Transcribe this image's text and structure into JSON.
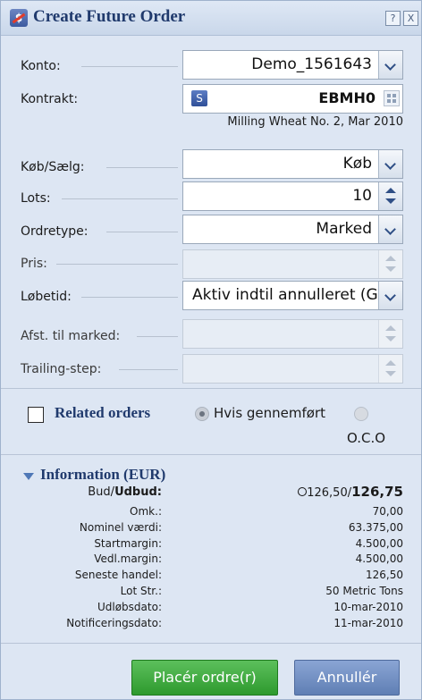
{
  "window": {
    "title": "Create Future Order",
    "help_label": "?",
    "close_label": "X"
  },
  "form": {
    "konto": {
      "label": "Konto:",
      "value": "Demo_1561643"
    },
    "kontrakt": {
      "label": "Kontrakt:",
      "badge": "S",
      "symbol": "EBMH0",
      "description": "Milling Wheat No. 2, Mar 2010"
    },
    "kob_saelg": {
      "label": "Køb/Sælg:",
      "value": "Køb"
    },
    "lots": {
      "label": "Lots:",
      "value": "10"
    },
    "ordretype": {
      "label": "Ordretype:",
      "value": "Marked"
    },
    "pris": {
      "label": "Pris:",
      "value": ""
    },
    "lobetid": {
      "label": "Løbetid:",
      "value": "Aktiv indtil annulleret (G"
    },
    "afst_til_marked": {
      "label": "Afst. til marked:",
      "value": ""
    },
    "trailing_step": {
      "label": "Trailing-step:",
      "value": ""
    }
  },
  "related": {
    "checkbox_label": "Related orders",
    "checked": false,
    "option1_label": "Hvis gennemført",
    "option2_label": "O.C.O"
  },
  "information": {
    "title": "Information (EUR)",
    "bid_label": "Bud/",
    "ask_label": "Udbud:",
    "bid_value": "126,50/",
    "ask_value": "126,75",
    "rows": [
      {
        "label": "Omk.:",
        "value": "70,00"
      },
      {
        "label": "Nominel værdi:",
        "value": "63.375,00"
      },
      {
        "label": "Startmargin:",
        "value": "4.500,00"
      },
      {
        "label": "Vedl.margin:",
        "value": "4.500,00"
      },
      {
        "label": "Seneste handel:",
        "value": "126,50"
      },
      {
        "label": "Lot Str.:",
        "value": "50 Metric Tons"
      },
      {
        "label": "Udløbsdato:",
        "value": "10-mar-2010"
      },
      {
        "label": "Notificeringsdato:",
        "value": "11-mar-2010"
      }
    ]
  },
  "buttons": {
    "place_label": "Placér ordre(r)",
    "cancel_label": "Annullér"
  },
  "colors": {
    "accent": "#203a6d",
    "place_button": "#2e9a2e",
    "cancel_button": "#5f7fb4"
  }
}
